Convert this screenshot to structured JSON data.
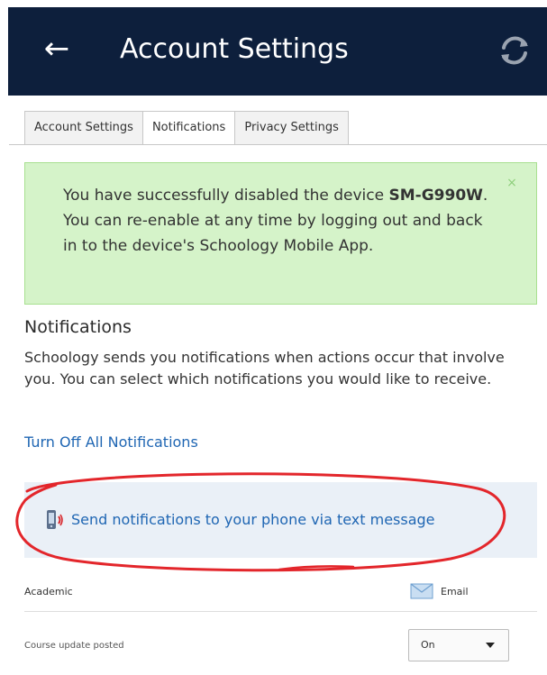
{
  "appbar": {
    "title": "Account Settings",
    "back_icon": "arrow-left-icon",
    "refresh_icon": "refresh-icon",
    "background": "#0d1f3c"
  },
  "tabs": [
    {
      "label": "Account Settings",
      "active": false
    },
    {
      "label": "Notifications",
      "active": true
    },
    {
      "label": "Privacy Settings",
      "active": false
    }
  ],
  "alert": {
    "text_before": "You have successfully disabled the device ",
    "device": "SM-G990W",
    "text_after": ". You can re-enable at any time by logging out and back in to the device's Schoology Mobile App.",
    "close_label": "×",
    "background": "#d5f3c9"
  },
  "notifications": {
    "title": "Notifications",
    "description": "Schoology sends you notifications when actions occur that involve you. You can select which notifications you would like to receive.",
    "turn_off_link": "Turn Off All Notifications",
    "sms_link": "Send notifications to your phone via text message",
    "sms_icon": "phone-icon",
    "link_color": "#1f66b3",
    "annotation_color": "#e3262b"
  },
  "table": {
    "category": "Academic",
    "email_column": "Email",
    "email_icon": "mail-icon",
    "rows": [
      {
        "label": "Course update posted",
        "value": "On"
      }
    ]
  }
}
